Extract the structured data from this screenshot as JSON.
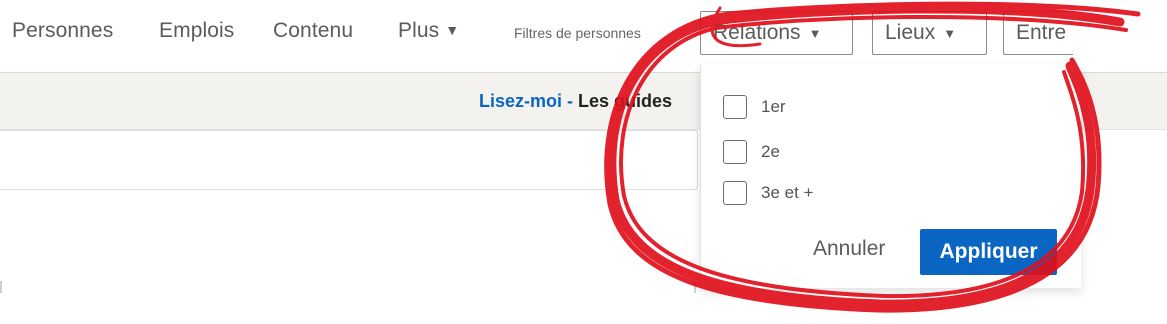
{
  "nav": {
    "people": "Personnes",
    "jobs": "Emplois",
    "content": "Contenu",
    "more": "Plus",
    "filters_label": "Filtres de personnes"
  },
  "filters": {
    "relations": "Relations",
    "locations": "Lieux",
    "companies": "Entre"
  },
  "banner": {
    "link": "Lisez-moi",
    "separator": " - ",
    "rest": "Les guides"
  },
  "dropdown": {
    "options": [
      {
        "label": "1er",
        "checked": false
      },
      {
        "label": "2e",
        "checked": false
      },
      {
        "label": "3e et +",
        "checked": false
      }
    ],
    "cancel": "Annuler",
    "apply": "Appliquer"
  },
  "colors": {
    "accent": "#0a66c2",
    "annotation": "#e0101c"
  },
  "icons": {
    "caret": "caret-down-icon"
  }
}
